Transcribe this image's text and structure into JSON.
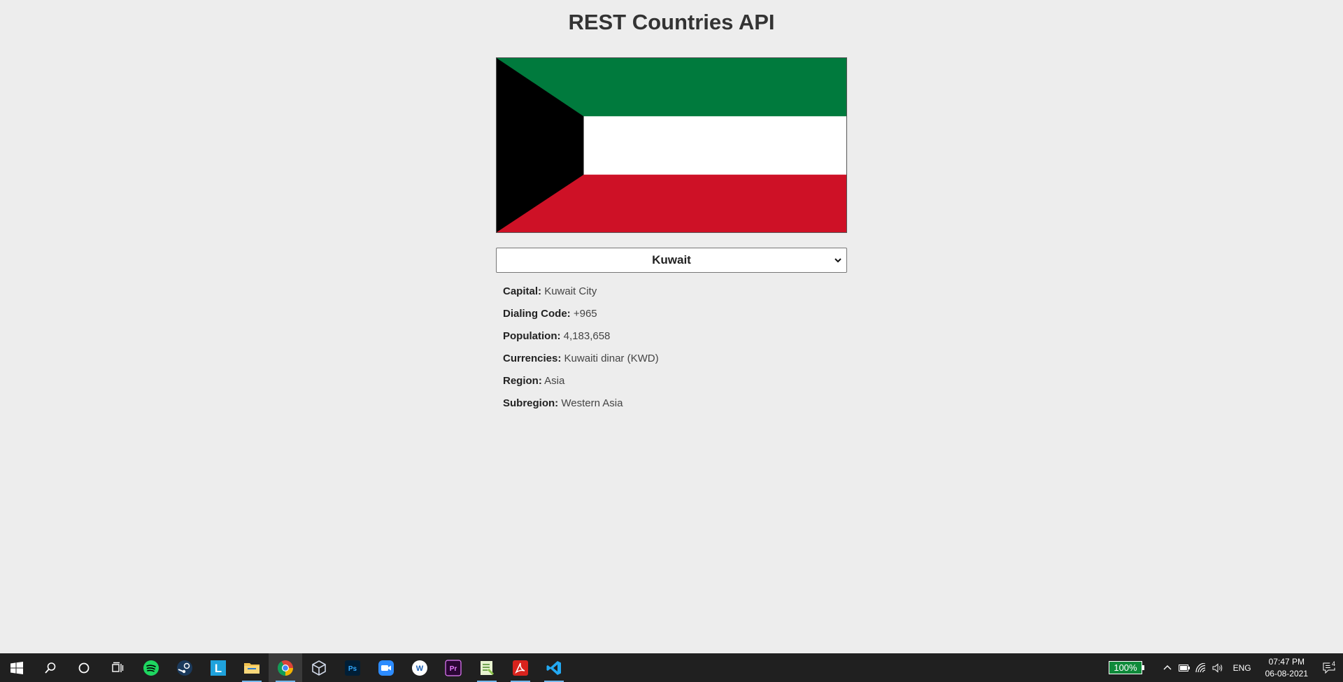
{
  "app": {
    "title": "REST Countries API"
  },
  "flag": {
    "country": "Kuwait",
    "colors": {
      "green": "#007a3d",
      "white": "#ffffff",
      "red": "#ce1126",
      "black": "#000000"
    }
  },
  "select": {
    "selected": "Kuwait"
  },
  "details": [
    {
      "label": "Capital:",
      "value": "Kuwait City"
    },
    {
      "label": "Dialing Code:",
      "value": "+965"
    },
    {
      "label": "Population:",
      "value": "4,183,658"
    },
    {
      "label": "Currencies:",
      "value": "Kuwaiti dinar (KWD)"
    },
    {
      "label": "Region:",
      "value": "Asia"
    },
    {
      "label": "Subregion:",
      "value": "Western Asia"
    }
  ],
  "taskbar": {
    "apps": [
      "windows-start-icon",
      "search-icon",
      "cortana-icon",
      "task-view-icon",
      "spotify-icon",
      "steam-icon",
      "l-app-icon",
      "file-explorer-icon",
      "chrome-icon",
      "virtualbox-icon",
      "photoshop-icon",
      "zoom-icon",
      "w-app-icon",
      "premiere-icon",
      "notepad-plus-icon",
      "acrobat-icon",
      "vscode-icon"
    ],
    "battery": "100%",
    "language": "ENG",
    "time": "07:47 PM",
    "date": "06-08-2021",
    "notifications": "4"
  }
}
